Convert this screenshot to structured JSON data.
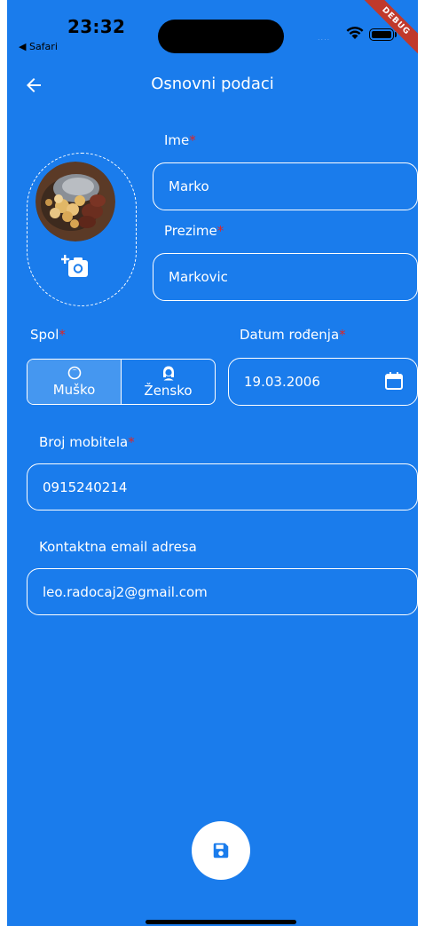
{
  "status_bar": {
    "time": "23:32",
    "back_app": "◀ Safari",
    "signal": "....",
    "debug_label": "DEBUG"
  },
  "appbar": {
    "title": "Osnovni podaci",
    "back_icon": "arrow-left-icon"
  },
  "form": {
    "first_name": {
      "label": "Ime",
      "required_mark": "*",
      "value": "Marko"
    },
    "last_name": {
      "label": "Prezime",
      "required_mark": "*",
      "value": "Markovic"
    },
    "gender": {
      "label": "Spol",
      "required_mark": "*",
      "options": [
        {
          "label": "Muško",
          "icon": "male-face-icon",
          "selected": true
        },
        {
          "label": "Žensko",
          "icon": "female-face-icon",
          "selected": false
        }
      ]
    },
    "birth_date": {
      "label": "Datum rođenja",
      "required_mark": "*",
      "value": "19.03.2006",
      "icon": "calendar-icon"
    },
    "phone": {
      "label": "Broj mobitela",
      "required_mark": "*",
      "value": "0915240214"
    },
    "email": {
      "label": "Kontaktna email adresa",
      "value": "leo.radocaj2@gmail.com"
    }
  },
  "photo": {
    "icon": "add-photo-icon"
  },
  "save_button": {
    "icon": "save-icon"
  },
  "colors": {
    "background": "#1a7cec",
    "selected_option": "#4597f0",
    "required": "#e02424",
    "debug_ribbon": "#c0392b"
  }
}
